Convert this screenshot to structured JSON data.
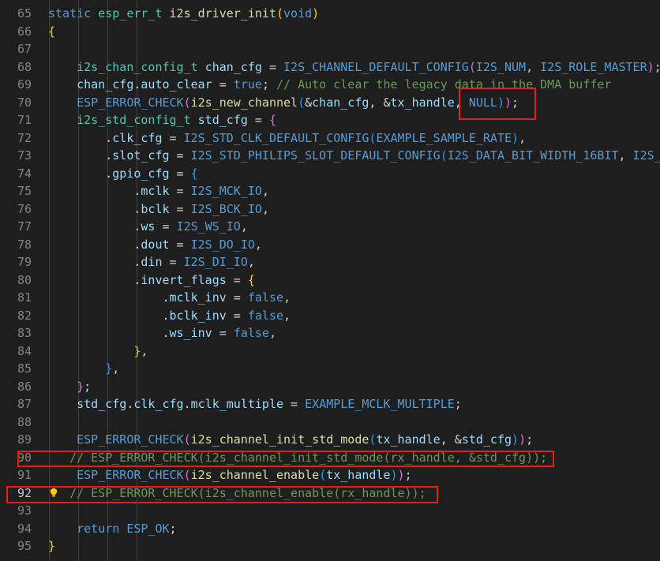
{
  "editor": {
    "active_line": 92,
    "lines": [
      {
        "no": "65",
        "tokens": [
          [
            "static ",
            "kw"
          ],
          [
            "esp_err_t ",
            "type"
          ],
          [
            "i2s_driver_init",
            "fn"
          ],
          [
            "(",
            "p1"
          ],
          [
            "void",
            "kw"
          ],
          [
            ")",
            "p1"
          ]
        ]
      },
      {
        "no": "66",
        "tokens": [
          [
            "{",
            "p1"
          ]
        ]
      },
      {
        "no": "67",
        "tokens": []
      },
      {
        "no": "68",
        "tokens": [
          [
            "    ",
            "op"
          ],
          [
            "i2s_chan_config_t ",
            "type"
          ],
          [
            "chan_cfg",
            "var"
          ],
          [
            " = ",
            "op"
          ],
          [
            "I2S_CHANNEL_DEFAULT_CONFIG",
            "mac"
          ],
          [
            "(",
            "p2"
          ],
          [
            "I2S_NUM",
            "mac"
          ],
          [
            ", ",
            "op"
          ],
          [
            "I2S_ROLE_MASTER",
            "mac"
          ],
          [
            ")",
            "p2"
          ],
          [
            ";",
            "op"
          ]
        ]
      },
      {
        "no": "69",
        "tokens": [
          [
            "    ",
            "op"
          ],
          [
            "chan_cfg",
            "var"
          ],
          [
            ".",
            "op"
          ],
          [
            "auto_clear",
            "var"
          ],
          [
            " = ",
            "op"
          ],
          [
            "true",
            "kw"
          ],
          [
            "; ",
            "op"
          ],
          [
            "// Auto clear the legacy data in the DMA buffer",
            "cm"
          ]
        ]
      },
      {
        "no": "70",
        "tokens": [
          [
            "    ",
            "op"
          ],
          [
            "ESP_ERROR_CHECK",
            "mac"
          ],
          [
            "(",
            "p2"
          ],
          [
            "i2s_new_channel",
            "fn"
          ],
          [
            "(",
            "p3"
          ],
          [
            "&",
            "op"
          ],
          [
            "chan_cfg",
            "var"
          ],
          [
            ", &",
            "op"
          ],
          [
            "tx_handle",
            "var"
          ],
          [
            ", ",
            "op"
          ],
          [
            "NULL",
            "mac"
          ],
          [
            ")",
            "p3"
          ],
          [
            ")",
            "p2"
          ],
          [
            ";",
            "op"
          ]
        ]
      },
      {
        "no": "71",
        "tokens": [
          [
            "    ",
            "op"
          ],
          [
            "i2s_std_config_t ",
            "type"
          ],
          [
            "std_cfg",
            "var"
          ],
          [
            " = ",
            "op"
          ],
          [
            "{",
            "p2"
          ]
        ]
      },
      {
        "no": "72",
        "tokens": [
          [
            "        .",
            "op"
          ],
          [
            "clk_cfg",
            "var"
          ],
          [
            " = ",
            "op"
          ],
          [
            "I2S_STD_CLK_DEFAULT_CONFIG",
            "mac"
          ],
          [
            "(",
            "p3"
          ],
          [
            "EXAMPLE_SAMPLE_RATE",
            "mac"
          ],
          [
            ")",
            "p3"
          ],
          [
            ",",
            "op"
          ]
        ]
      },
      {
        "no": "73",
        "tokens": [
          [
            "        .",
            "op"
          ],
          [
            "slot_cfg",
            "var"
          ],
          [
            " = ",
            "op"
          ],
          [
            "I2S_STD_PHILIPS_SLOT_DEFAULT_CONFIG",
            "mac"
          ],
          [
            "(",
            "p3"
          ],
          [
            "I2S_DATA_BIT_WIDTH_16BIT",
            "mac"
          ],
          [
            ", ",
            "op"
          ],
          [
            "I2S_",
            "mac"
          ]
        ]
      },
      {
        "no": "74",
        "tokens": [
          [
            "        .",
            "op"
          ],
          [
            "gpio_cfg",
            "var"
          ],
          [
            " = ",
            "op"
          ],
          [
            "{",
            "p3"
          ]
        ]
      },
      {
        "no": "75",
        "tokens": [
          [
            "            .",
            "op"
          ],
          [
            "mclk",
            "var"
          ],
          [
            " = ",
            "op"
          ],
          [
            "I2S_MCK_IO",
            "mac"
          ],
          [
            ",",
            "op"
          ]
        ]
      },
      {
        "no": "76",
        "tokens": [
          [
            "            .",
            "op"
          ],
          [
            "bclk",
            "var"
          ],
          [
            " = ",
            "op"
          ],
          [
            "I2S_BCK_IO",
            "mac"
          ],
          [
            ",",
            "op"
          ]
        ]
      },
      {
        "no": "77",
        "tokens": [
          [
            "            .",
            "op"
          ],
          [
            "ws",
            "var"
          ],
          [
            " = ",
            "op"
          ],
          [
            "I2S_WS_IO",
            "mac"
          ],
          [
            ",",
            "op"
          ]
        ]
      },
      {
        "no": "78",
        "tokens": [
          [
            "            .",
            "op"
          ],
          [
            "dout",
            "var"
          ],
          [
            " = ",
            "op"
          ],
          [
            "I2S_DO_IO",
            "mac"
          ],
          [
            ",",
            "op"
          ]
        ]
      },
      {
        "no": "79",
        "tokens": [
          [
            "            .",
            "op"
          ],
          [
            "din",
            "var"
          ],
          [
            " = ",
            "op"
          ],
          [
            "I2S_DI_IO",
            "mac"
          ],
          [
            ",",
            "op"
          ]
        ]
      },
      {
        "no": "80",
        "tokens": [
          [
            "            .",
            "op"
          ],
          [
            "invert_flags",
            "var"
          ],
          [
            " = ",
            "op"
          ],
          [
            "{",
            "p1"
          ]
        ]
      },
      {
        "no": "81",
        "tokens": [
          [
            "                .",
            "op"
          ],
          [
            "mclk_inv",
            "var"
          ],
          [
            " = ",
            "op"
          ],
          [
            "false",
            "kw"
          ],
          [
            ",",
            "op"
          ]
        ]
      },
      {
        "no": "82",
        "tokens": [
          [
            "                .",
            "op"
          ],
          [
            "bclk_inv",
            "var"
          ],
          [
            " = ",
            "op"
          ],
          [
            "false",
            "kw"
          ],
          [
            ",",
            "op"
          ]
        ]
      },
      {
        "no": "83",
        "tokens": [
          [
            "                .",
            "op"
          ],
          [
            "ws_inv",
            "var"
          ],
          [
            " = ",
            "op"
          ],
          [
            "false",
            "kw"
          ],
          [
            ",",
            "op"
          ]
        ]
      },
      {
        "no": "84",
        "tokens": [
          [
            "            ",
            "op"
          ],
          [
            "}",
            "p1"
          ],
          [
            ",",
            "op"
          ]
        ]
      },
      {
        "no": "85",
        "tokens": [
          [
            "        ",
            "op"
          ],
          [
            "}",
            "p3"
          ],
          [
            ",",
            "op"
          ]
        ]
      },
      {
        "no": "86",
        "tokens": [
          [
            "    ",
            "op"
          ],
          [
            "}",
            "p2"
          ],
          [
            ";",
            "op"
          ]
        ]
      },
      {
        "no": "87",
        "tokens": [
          [
            "    ",
            "op"
          ],
          [
            "std_cfg",
            "var"
          ],
          [
            ".",
            "op"
          ],
          [
            "clk_cfg",
            "var"
          ],
          [
            ".",
            "op"
          ],
          [
            "mclk_multiple",
            "var"
          ],
          [
            " = ",
            "op"
          ],
          [
            "EXAMPLE_MCLK_MULTIPLE",
            "mac"
          ],
          [
            ";",
            "op"
          ]
        ]
      },
      {
        "no": "88",
        "tokens": []
      },
      {
        "no": "89",
        "tokens": [
          [
            "    ",
            "op"
          ],
          [
            "ESP_ERROR_CHECK",
            "mac"
          ],
          [
            "(",
            "p2"
          ],
          [
            "i2s_channel_init_std_mode",
            "fn"
          ],
          [
            "(",
            "p3"
          ],
          [
            "tx_handle",
            "var"
          ],
          [
            ", &",
            "op"
          ],
          [
            "std_cfg",
            "var"
          ],
          [
            ")",
            "p3"
          ],
          [
            ")",
            "p2"
          ],
          [
            ";",
            "op"
          ]
        ]
      },
      {
        "no": "90",
        "tokens": [
          [
            "   ",
            "op"
          ],
          [
            "// ESP_ERROR_CHECK(i2s_channel_init_std_mode(rx_handle, &std_cfg));",
            "cm"
          ]
        ]
      },
      {
        "no": "91",
        "tokens": [
          [
            "    ",
            "op"
          ],
          [
            "ESP_ERROR_CHECK",
            "mac"
          ],
          [
            "(",
            "p2"
          ],
          [
            "i2s_channel_enable",
            "fn"
          ],
          [
            "(",
            "p3"
          ],
          [
            "tx_handle",
            "var"
          ],
          [
            ")",
            "p3"
          ],
          [
            ")",
            "p2"
          ],
          [
            ";",
            "op"
          ]
        ]
      },
      {
        "no": "92",
        "tokens": [
          [
            "   ",
            "op"
          ],
          [
            "// ESP_ERROR_CHECK(i2s_channel_enable(rx_handle));",
            "cm"
          ]
        ]
      },
      {
        "no": "93",
        "tokens": []
      },
      {
        "no": "94",
        "tokens": [
          [
            "    ",
            "op"
          ],
          [
            "return ",
            "kw"
          ],
          [
            "ESP_OK",
            "mac"
          ],
          [
            ";",
            "op"
          ]
        ]
      },
      {
        "no": "95",
        "tokens": [
          [
            "}",
            "p1"
          ]
        ]
      }
    ]
  },
  "highlights": [
    {
      "name": "highlight-null-arg"
    },
    {
      "name": "highlight-line-90"
    },
    {
      "name": "highlight-line-92"
    }
  ],
  "icons": {
    "lightbulb": "lightbulb-icon"
  }
}
